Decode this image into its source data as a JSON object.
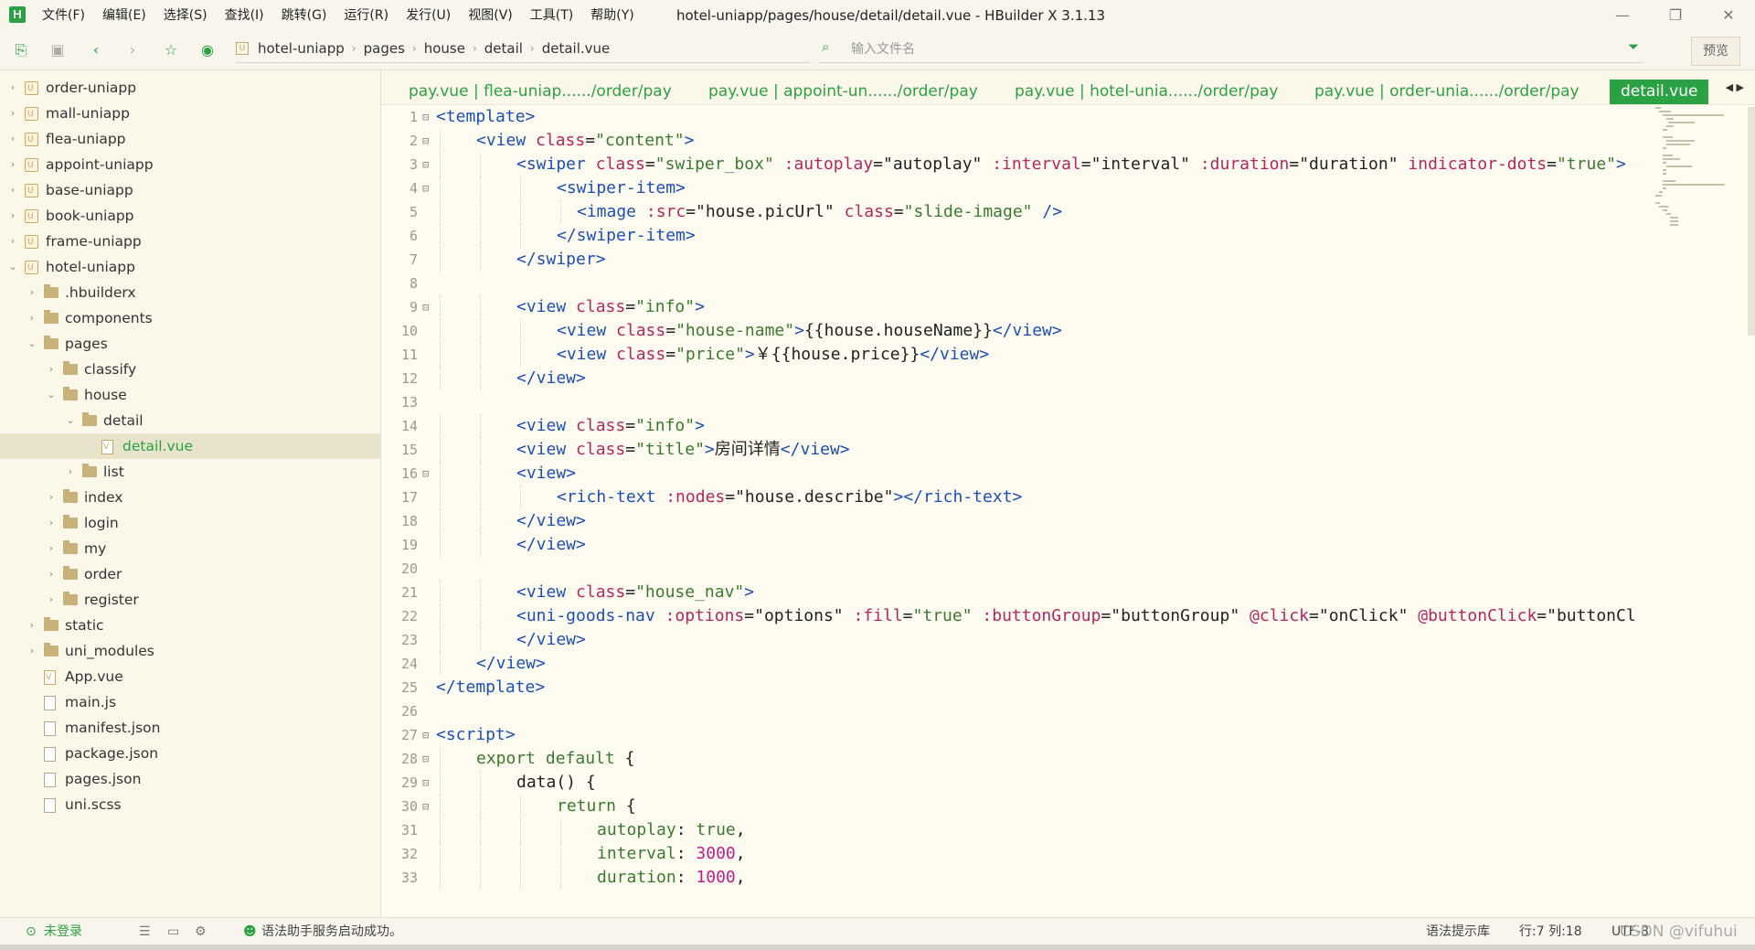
{
  "app": {
    "window_title": "hotel-uniapp/pages/house/detail/detail.vue - HBuilder X 3.1.13",
    "logo_text": "H"
  },
  "menu": [
    "文件(F)",
    "编辑(E)",
    "选择(S)",
    "查找(I)",
    "跳转(G)",
    "运行(R)",
    "发行(U)",
    "视图(V)",
    "工具(T)",
    "帮助(Y)"
  ],
  "toolbar": {
    "breadcrumb": [
      "hotel-uniapp",
      "pages",
      "house",
      "detail",
      "detail.vue"
    ],
    "file_search_placeholder": "输入文件名",
    "preview_label": "预览"
  },
  "sidebar": {
    "tree": [
      {
        "label": "order-uniapp",
        "type": "project",
        "depth": 0,
        "expanded": false
      },
      {
        "label": "mall-uniapp",
        "type": "project",
        "depth": 0,
        "expanded": false
      },
      {
        "label": "flea-uniapp",
        "type": "project",
        "depth": 0,
        "expanded": false
      },
      {
        "label": "appoint-uniapp",
        "type": "project",
        "depth": 0,
        "expanded": false
      },
      {
        "label": "base-uniapp",
        "type": "project",
        "depth": 0,
        "expanded": false
      },
      {
        "label": "book-uniapp",
        "type": "project",
        "depth": 0,
        "expanded": false
      },
      {
        "label": "frame-uniapp",
        "type": "project",
        "depth": 0,
        "expanded": false
      },
      {
        "label": "hotel-uniapp",
        "type": "project",
        "depth": 0,
        "expanded": true
      },
      {
        "label": ".hbuilderx",
        "type": "folder",
        "depth": 1,
        "expanded": false
      },
      {
        "label": "components",
        "type": "folder",
        "depth": 1,
        "expanded": false
      },
      {
        "label": "pages",
        "type": "folder",
        "depth": 1,
        "expanded": true
      },
      {
        "label": "classify",
        "type": "folder",
        "depth": 2,
        "expanded": false
      },
      {
        "label": "house",
        "type": "folder",
        "depth": 2,
        "expanded": true
      },
      {
        "label": "detail",
        "type": "folder",
        "depth": 3,
        "expanded": true
      },
      {
        "label": "detail.vue",
        "type": "vue",
        "depth": 4,
        "selected": true
      },
      {
        "label": "list",
        "type": "folder",
        "depth": 3,
        "expanded": false
      },
      {
        "label": "index",
        "type": "folder",
        "depth": 2,
        "expanded": false
      },
      {
        "label": "login",
        "type": "folder",
        "depth": 2,
        "expanded": false
      },
      {
        "label": "my",
        "type": "folder",
        "depth": 2,
        "expanded": false
      },
      {
        "label": "order",
        "type": "folder",
        "depth": 2,
        "expanded": false
      },
      {
        "label": "register",
        "type": "folder",
        "depth": 2,
        "expanded": false
      },
      {
        "label": "static",
        "type": "folder",
        "depth": 1,
        "expanded": false
      },
      {
        "label": "uni_modules",
        "type": "folder",
        "depth": 1,
        "expanded": false
      },
      {
        "label": "App.vue",
        "type": "vue",
        "depth": 1
      },
      {
        "label": "main.js",
        "type": "file",
        "depth": 1
      },
      {
        "label": "manifest.json",
        "type": "file",
        "depth": 1
      },
      {
        "label": "package.json",
        "type": "file",
        "depth": 1
      },
      {
        "label": "pages.json",
        "type": "file",
        "depth": 1
      },
      {
        "label": "uni.scss",
        "type": "file",
        "depth": 1
      }
    ]
  },
  "tabs": [
    {
      "label": "pay.vue | flea-uniap....../order/pay",
      "active": false
    },
    {
      "label": "pay.vue | appoint-un....../order/pay",
      "active": false
    },
    {
      "label": "pay.vue | hotel-unia....../order/pay",
      "active": false
    },
    {
      "label": "pay.vue | order-unia....../order/pay",
      "active": false
    },
    {
      "label": "detail.vue",
      "active": true
    }
  ],
  "code": [
    {
      "n": "1",
      "fold": "⊟",
      "indent": 0,
      "t": [
        [
          "tag",
          "<template>"
        ]
      ]
    },
    {
      "n": "2",
      "fold": "⊟",
      "indent": 1,
      "t": [
        [
          "tag",
          "<view "
        ],
        [
          "attr",
          "class"
        ],
        [
          "txt",
          "="
        ],
        [
          "str",
          "\"content\""
        ],
        [
          "tag",
          ">"
        ]
      ]
    },
    {
      "n": "3",
      "fold": "⊟",
      "indent": 2,
      "t": [
        [
          "tag",
          "<swiper "
        ],
        [
          "attr",
          "class"
        ],
        [
          "txt",
          "="
        ],
        [
          "str",
          "\"swiper_box\""
        ],
        [
          "txt",
          " "
        ],
        [
          "attr",
          ":autoplay"
        ],
        [
          "txt",
          "=\"autoplay\" "
        ],
        [
          "attr",
          ":interval"
        ],
        [
          "txt",
          "=\"interval\" "
        ],
        [
          "attr",
          ":duration"
        ],
        [
          "txt",
          "=\"duration\" "
        ],
        [
          "attr",
          "indicator-dots"
        ],
        [
          "txt",
          "="
        ],
        [
          "str",
          "\"true\""
        ],
        [
          "tag",
          ">"
        ]
      ]
    },
    {
      "n": "4",
      "fold": "⊟",
      "indent": 3,
      "t": [
        [
          "tag",
          "<swiper-item>"
        ]
      ]
    },
    {
      "n": "5",
      "fold": "",
      "indent": 3.5,
      "t": [
        [
          "tag",
          "<image "
        ],
        [
          "attr",
          ":src"
        ],
        [
          "txt",
          "=\"house.picUrl\" "
        ],
        [
          "attr",
          "class"
        ],
        [
          "txt",
          "="
        ],
        [
          "str",
          "\"slide-image\""
        ],
        [
          "tag",
          " />"
        ]
      ]
    },
    {
      "n": "6",
      "fold": "",
      "indent": 3,
      "t": [
        [
          "tag",
          "</swiper-item>"
        ]
      ]
    },
    {
      "n": "7",
      "fold": "",
      "indent": 2,
      "t": [
        [
          "tag",
          "</swiper>"
        ]
      ]
    },
    {
      "n": "8",
      "fold": "",
      "indent": 0,
      "t": []
    },
    {
      "n": "9",
      "fold": "⊟",
      "indent": 2,
      "t": [
        [
          "tag",
          "<view "
        ],
        [
          "attr",
          "class"
        ],
        [
          "txt",
          "="
        ],
        [
          "str",
          "\"info\""
        ],
        [
          "tag",
          ">"
        ]
      ]
    },
    {
      "n": "10",
      "fold": "",
      "indent": 3,
      "t": [
        [
          "tag",
          "<view "
        ],
        [
          "attr",
          "class"
        ],
        [
          "txt",
          "="
        ],
        [
          "str",
          "\"house-name\""
        ],
        [
          "tag",
          ">"
        ],
        [
          "txt",
          "{{house.houseName}}"
        ],
        [
          "tag",
          "</view>"
        ]
      ]
    },
    {
      "n": "11",
      "fold": "",
      "indent": 3,
      "t": [
        [
          "tag",
          "<view "
        ],
        [
          "attr",
          "class"
        ],
        [
          "txt",
          "="
        ],
        [
          "str",
          "\"price\""
        ],
        [
          "tag",
          ">"
        ],
        [
          "txt",
          "￥{{house.price}}"
        ],
        [
          "tag",
          "</view>"
        ]
      ]
    },
    {
      "n": "12",
      "fold": "",
      "indent": 2,
      "t": [
        [
          "tag",
          "</view>"
        ]
      ]
    },
    {
      "n": "13",
      "fold": "",
      "indent": 0,
      "t": []
    },
    {
      "n": "14",
      "fold": "",
      "indent": 2,
      "t": [
        [
          "tag",
          "<view "
        ],
        [
          "attr",
          "class"
        ],
        [
          "txt",
          "="
        ],
        [
          "str",
          "\"info\""
        ],
        [
          "tag",
          ">"
        ]
      ]
    },
    {
      "n": "15",
      "fold": "",
      "indent": 2,
      "t": [
        [
          "tag",
          "<view "
        ],
        [
          "attr",
          "class"
        ],
        [
          "txt",
          "="
        ],
        [
          "str",
          "\"title\""
        ],
        [
          "tag",
          ">"
        ],
        [
          "txt",
          "房间详情"
        ],
        [
          "tag",
          "</view>"
        ]
      ]
    },
    {
      "n": "16",
      "fold": "⊟",
      "indent": 2,
      "t": [
        [
          "tag",
          "<view>"
        ]
      ]
    },
    {
      "n": "17",
      "fold": "",
      "indent": 3,
      "t": [
        [
          "tag",
          "<rich-text "
        ],
        [
          "attr",
          ":nodes"
        ],
        [
          "txt",
          "=\"house.describe\""
        ],
        [
          "tag",
          "></rich-text>"
        ]
      ]
    },
    {
      "n": "18",
      "fold": "",
      "indent": 2,
      "t": [
        [
          "tag",
          "</view>"
        ]
      ]
    },
    {
      "n": "19",
      "fold": "",
      "indent": 2,
      "t": [
        [
          "tag",
          "</view>"
        ]
      ]
    },
    {
      "n": "20",
      "fold": "",
      "indent": 0,
      "t": []
    },
    {
      "n": "21",
      "fold": "",
      "indent": 2,
      "t": [
        [
          "tag",
          "<view "
        ],
        [
          "attr",
          "class"
        ],
        [
          "txt",
          "="
        ],
        [
          "str",
          "\"house_nav\""
        ],
        [
          "tag",
          ">"
        ]
      ]
    },
    {
      "n": "22",
      "fold": "",
      "indent": 2,
      "t": [
        [
          "tag",
          "<uni-goods-nav "
        ],
        [
          "attr",
          ":options"
        ],
        [
          "txt",
          "=\"options\" "
        ],
        [
          "attr",
          ":fill"
        ],
        [
          "txt",
          "="
        ],
        [
          "str",
          "\"true\""
        ],
        [
          "txt",
          " "
        ],
        [
          "attr",
          ":buttonGroup"
        ],
        [
          "txt",
          "=\"buttonGroup\" "
        ],
        [
          "attr",
          "@click"
        ],
        [
          "txt",
          "=\"onClick\" "
        ],
        [
          "attr",
          "@buttonClick"
        ],
        [
          "txt",
          "=\"buttonCl"
        ]
      ]
    },
    {
      "n": "23",
      "fold": "",
      "indent": 2,
      "t": [
        [
          "tag",
          "</view>"
        ]
      ]
    },
    {
      "n": "24",
      "fold": "",
      "indent": 1,
      "t": [
        [
          "tag",
          "</view>"
        ]
      ]
    },
    {
      "n": "25",
      "fold": "",
      "indent": 0,
      "t": [
        [
          "tag",
          "</template>"
        ]
      ]
    },
    {
      "n": "26",
      "fold": "",
      "indent": 0,
      "t": []
    },
    {
      "n": "27",
      "fold": "⊟",
      "indent": 0,
      "t": [
        [
          "tag",
          "<script>"
        ]
      ]
    },
    {
      "n": "28",
      "fold": "⊟",
      "indent": 1,
      "t": [
        [
          "kw",
          "export default "
        ],
        [
          "txt",
          "{"
        ]
      ]
    },
    {
      "n": "29",
      "fold": "⊟",
      "indent": 2,
      "t": [
        [
          "txt",
          "data() {"
        ]
      ]
    },
    {
      "n": "30",
      "fold": "⊟",
      "indent": 3,
      "t": [
        [
          "kw",
          "return "
        ],
        [
          "txt",
          "{"
        ]
      ]
    },
    {
      "n": "31",
      "fold": "",
      "indent": 4,
      "t": [
        [
          "kw",
          "autoplay"
        ],
        [
          "txt",
          ": "
        ],
        [
          "kw",
          "true"
        ],
        [
          "txt",
          ","
        ]
      ]
    },
    {
      "n": "32",
      "fold": "",
      "indent": 4,
      "t": [
        [
          "kw",
          "interval"
        ],
        [
          "txt",
          ": "
        ],
        [
          "num",
          "3000"
        ],
        [
          "txt",
          ","
        ]
      ]
    },
    {
      "n": "33",
      "fold": "",
      "indent": 4,
      "t": [
        [
          "kw",
          "duration"
        ],
        [
          "txt",
          ": "
        ],
        [
          "num",
          "1000"
        ],
        [
          "txt",
          ","
        ]
      ]
    }
  ],
  "statusbar": {
    "login": "未登录",
    "message": "语法助手服务启动成功。",
    "syntax_lib": "语法提示库",
    "position": "行:7  列:18",
    "encoding": "UTF-8",
    "watermark": "CSDN @vifuhui"
  }
}
